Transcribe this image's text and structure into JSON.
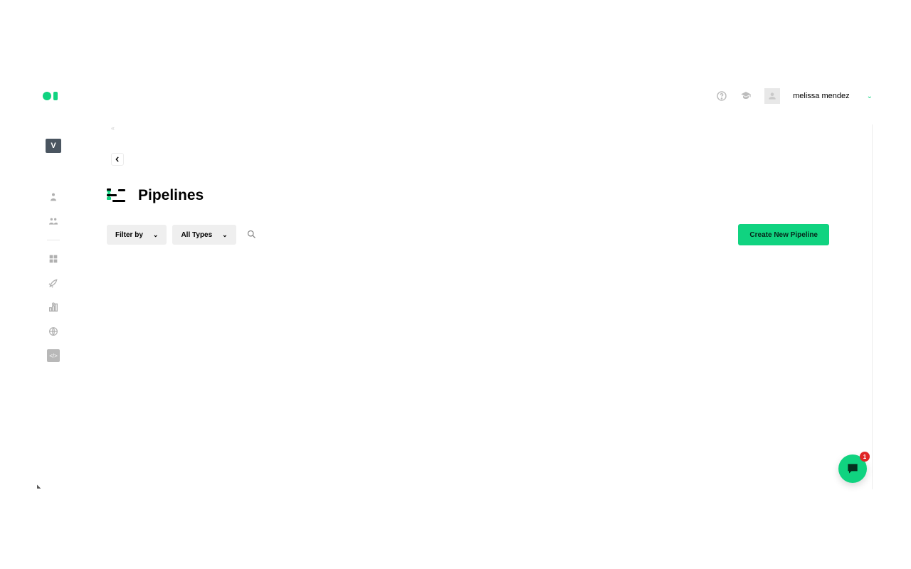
{
  "header": {
    "user_name": "melissa mendez"
  },
  "sidebar": {
    "active_letter": "V"
  },
  "main": {
    "collapse_hint": "«",
    "page_title": "Pipelines",
    "filter_label": "Filter by",
    "types_label": "All Types",
    "create_label": "Create New Pipeline"
  },
  "chat": {
    "badge_count": "1"
  }
}
